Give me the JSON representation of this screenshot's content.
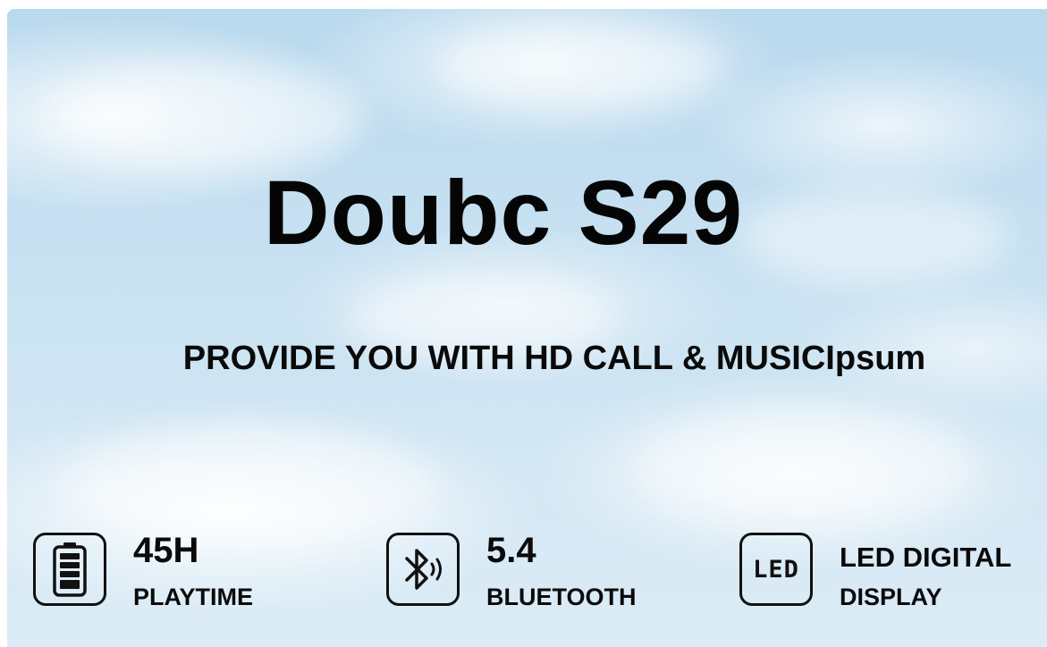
{
  "banner": {
    "title": "Doubc S29",
    "subtitle": "PROVIDE YOU WITH HD CALL & MUSICIpsum"
  },
  "features": [
    {
      "icon": "battery-icon",
      "value": "45H",
      "label": "PLAYTIME"
    },
    {
      "icon": "bluetooth-icon",
      "value": "5.4",
      "label": "BLUETOOTH"
    },
    {
      "icon": "led-icon",
      "icon_text": "LED",
      "value": "LED DIGITAL",
      "label": "DISPLAY"
    }
  ],
  "colors": {
    "text": "#0a0a0a",
    "sky_top": "#b9d9ee",
    "sky_bottom": "#dcecf6"
  }
}
